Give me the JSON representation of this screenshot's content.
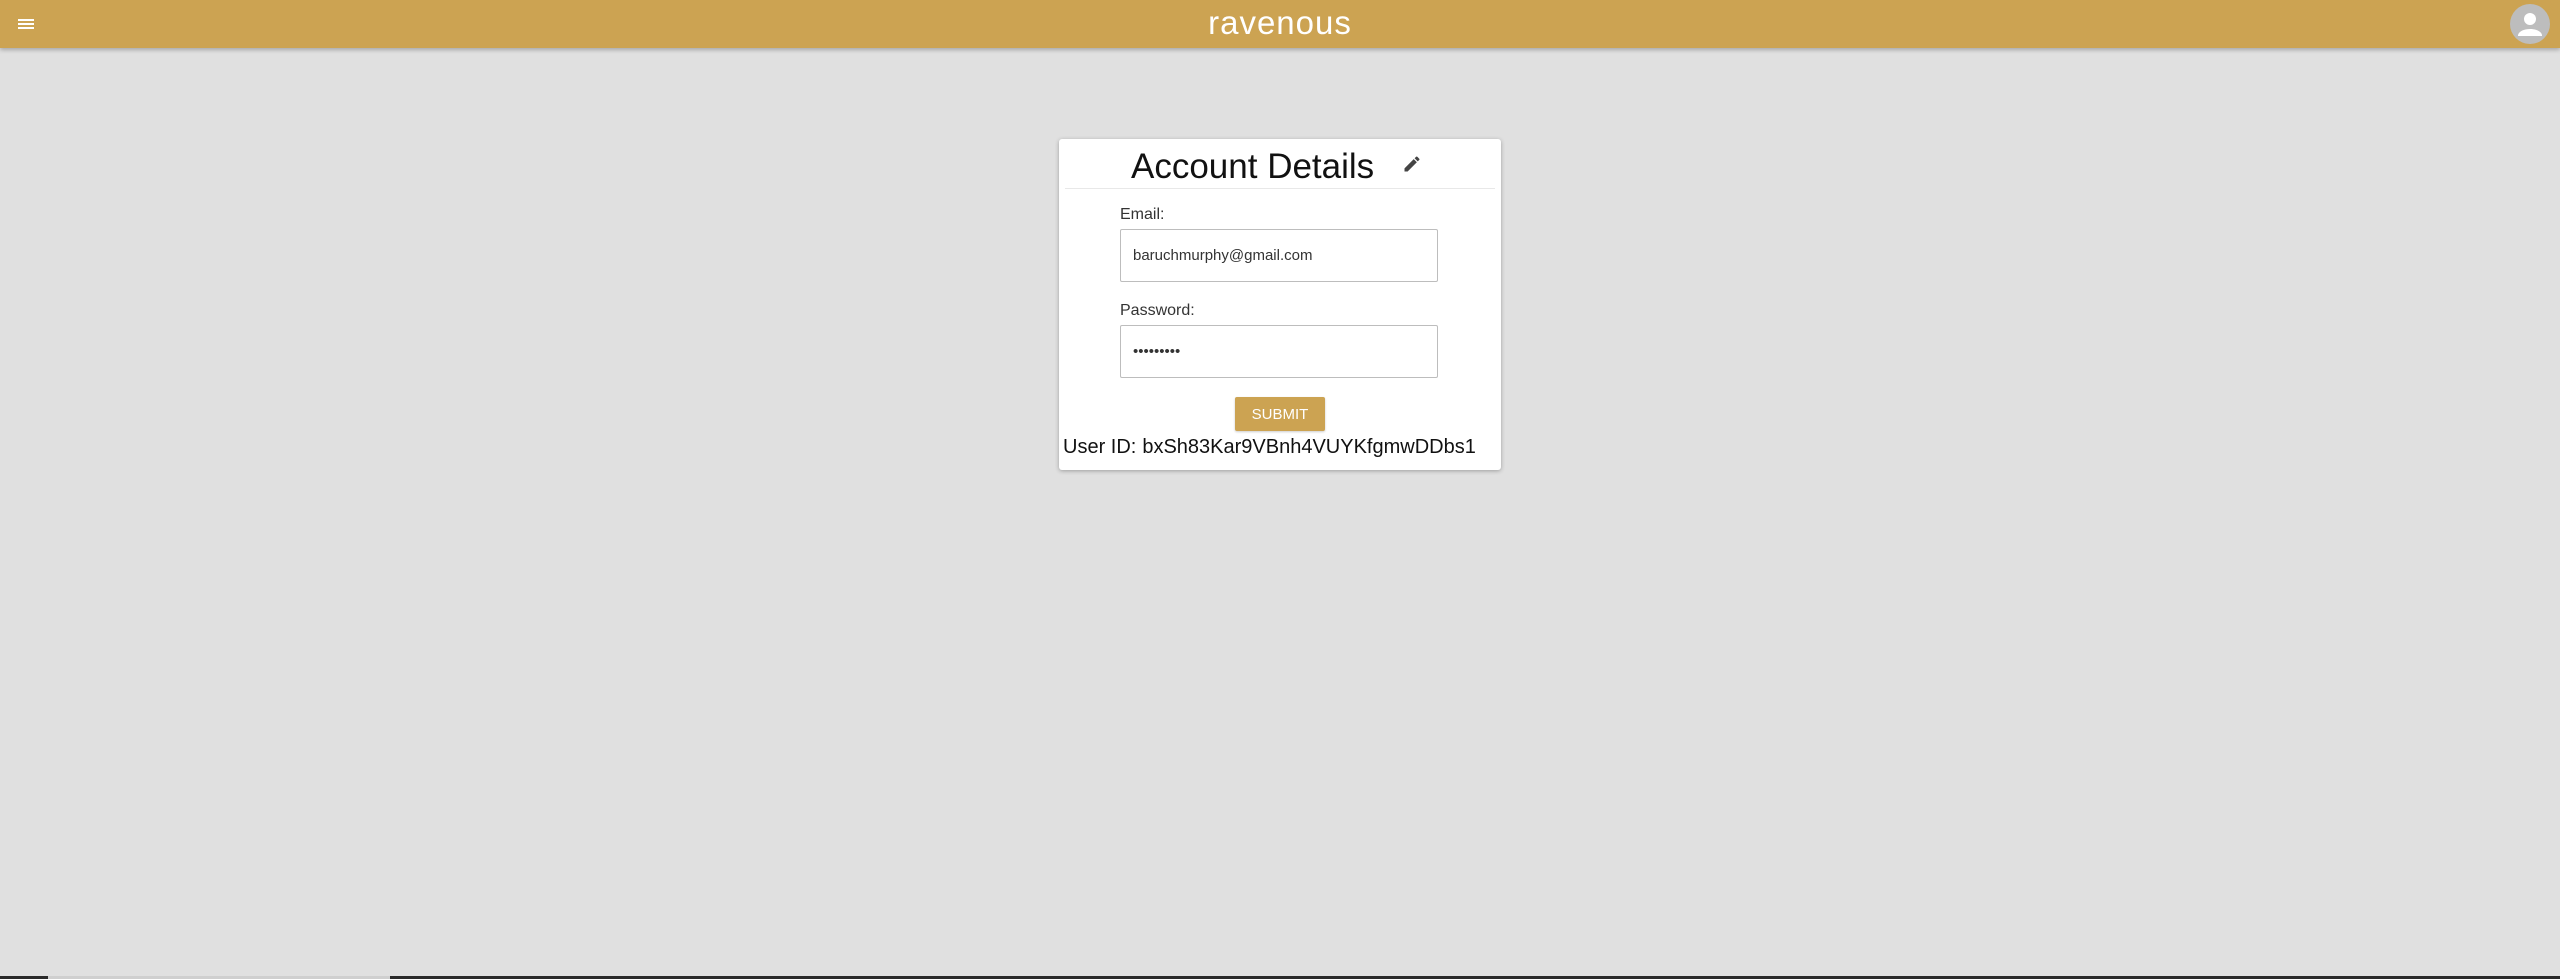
{
  "app": {
    "title": "ravenous",
    "brand_color": "#cca352",
    "background_color": "#e0e0e0"
  },
  "topbar": {
    "menu_icon": "menu-icon",
    "avatar_icon": "account-circle-icon"
  },
  "account_card": {
    "title": "Account Details",
    "edit_icon": "pencil-icon",
    "email": {
      "label": "Email:",
      "value": "baruchmurphy@gmail.com"
    },
    "password": {
      "label": "Password:",
      "value": "•••••••••"
    },
    "submit_label": "SUBMIT",
    "user_id": {
      "label": "User ID:",
      "value": "bxSh83Kar9VBnh4VUYKfgmwDDbs1"
    }
  }
}
